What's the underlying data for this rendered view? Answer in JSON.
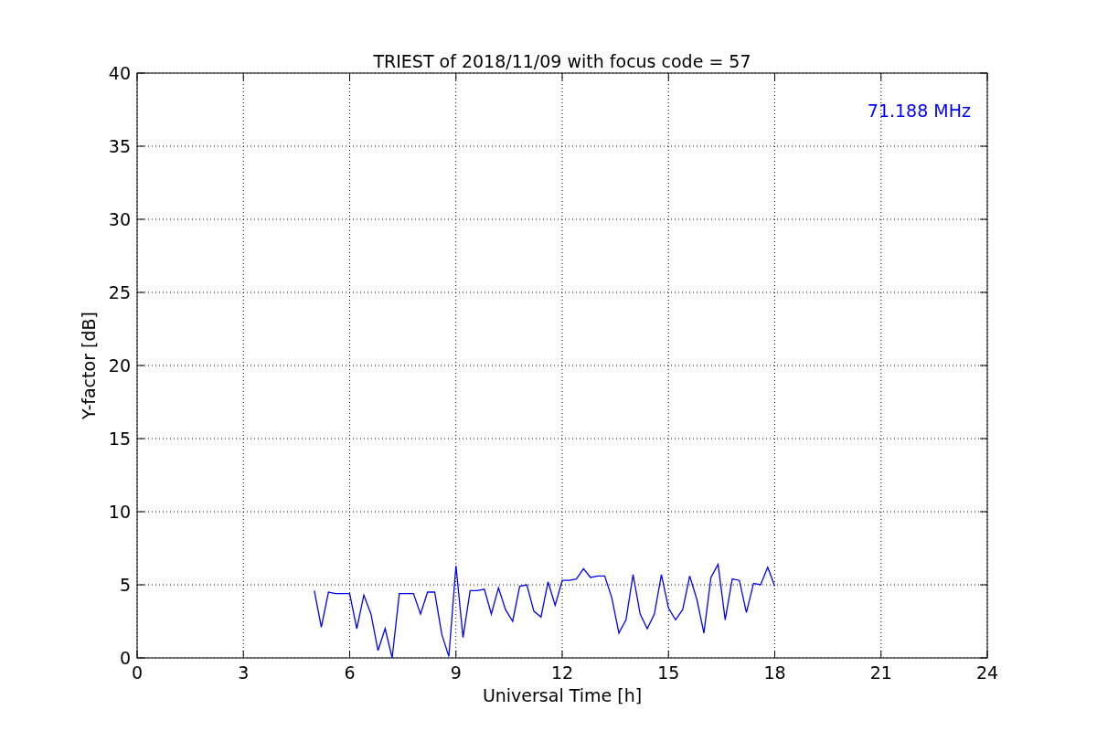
{
  "figure": {
    "chart_data": {
      "type": "line",
      "title": "TRIEST of 2018/11/09 with focus code = 57",
      "xlabel": "Universal Time [h]",
      "ylabel": "Y-factor [dB]",
      "x": [
        5.0,
        5.2,
        5.4,
        5.6,
        5.8,
        6.0,
        6.2,
        6.4,
        6.6,
        6.8,
        7.0,
        7.2,
        7.4,
        7.6,
        7.8,
        8.0,
        8.2,
        8.4,
        8.6,
        8.8,
        9.0,
        9.2,
        9.4,
        9.6,
        9.8,
        10.0,
        10.2,
        10.4,
        10.6,
        10.8,
        11.0,
        11.2,
        11.4,
        11.6,
        11.8,
        12.0,
        12.2,
        12.4,
        12.6,
        12.8,
        13.0,
        13.2,
        13.4,
        13.6,
        13.8,
        14.0,
        14.2,
        14.4,
        14.6,
        14.8,
        15.0,
        15.2,
        15.4,
        15.6,
        15.8,
        16.0,
        16.2,
        16.4,
        16.6,
        16.8,
        17.0,
        17.2,
        17.4,
        17.6,
        17.8,
        18.0
      ],
      "series": [
        {
          "color": "#0000ff",
          "values": [
            4.6,
            2.1,
            4.5,
            4.4,
            4.4,
            4.4,
            2.0,
            4.3,
            3.0,
            0.5,
            2.0,
            0.0,
            4.4,
            4.4,
            4.4,
            3.0,
            4.5,
            4.5,
            1.6,
            0.1,
            6.3,
            1.4,
            4.6,
            4.6,
            4.7,
            3.0,
            4.8,
            3.3,
            2.5,
            4.9,
            5.0,
            3.2,
            2.8,
            5.2,
            3.6,
            5.3,
            5.3,
            5.4,
            6.1,
            5.5,
            5.6,
            5.6,
            4.1,
            1.7,
            2.6,
            5.7,
            3.0,
            2.0,
            3.0,
            5.7,
            3.4,
            2.6,
            3.3,
            5.6,
            4.0,
            1.7,
            5.5,
            6.4,
            2.6,
            5.4,
            5.3,
            3.1,
            5.1,
            5.0,
            6.2,
            4.9
          ]
        }
      ],
      "xlim": [
        0,
        24
      ],
      "ylim": [
        0,
        40
      ],
      "xticks": [
        0,
        3,
        6,
        9,
        12,
        15,
        18,
        21,
        24
      ],
      "yticks": [
        0,
        5,
        10,
        15,
        20,
        25,
        30,
        35,
        40
      ],
      "grid": true,
      "annotations": [
        {
          "text": "71.188 MHz"
        }
      ]
    }
  }
}
